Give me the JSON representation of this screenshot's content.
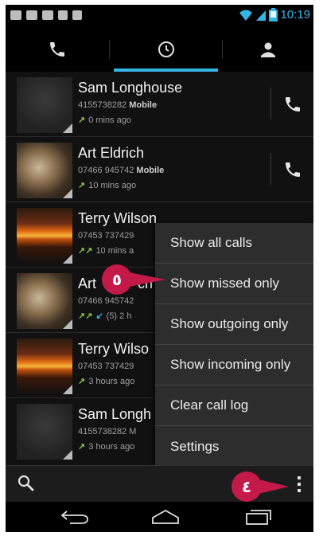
{
  "status_bar": {
    "time": "10:19",
    "notification_icons": [
      "message-icon",
      "email-icon",
      "voicemail-icon",
      "download-icon",
      "download-icon"
    ],
    "status_icons": [
      "wifi-icon",
      "signal-icon",
      "battery-icon"
    ]
  },
  "tabs": [
    {
      "icon": "phone-icon",
      "selected": false
    },
    {
      "icon": "clock-icon",
      "selected": true
    },
    {
      "icon": "contact-icon",
      "selected": false
    }
  ],
  "call_log": [
    {
      "name": "Sam Longhouse",
      "number": "4155738282",
      "type": "Mobile",
      "direction": "outgoing",
      "time": "0 mins ago",
      "avatar": "default"
    },
    {
      "name": "Art Eldrich",
      "number": "07466 945742",
      "type": "Mobile",
      "direction": "outgoing",
      "time": "10 mins ago",
      "avatar": "cat"
    },
    {
      "name": "Terry Wilson",
      "number": "07453 737429",
      "type": "",
      "direction": "outgoing",
      "time": "10 mins a",
      "avatar": "sunset"
    },
    {
      "name": "Art",
      "name_tail": "ch",
      "number": "07466 945742",
      "type": "",
      "direction": "mixed",
      "time": "(5) 2 h",
      "avatar": "cat"
    },
    {
      "name": "Terry Wilso",
      "number": "07453 737429",
      "type": "",
      "direction": "outgoing",
      "time": "3 hours ago",
      "avatar": "sunset"
    },
    {
      "name": "Sam Longh",
      "number": "4155738282 M",
      "type": "",
      "direction": "outgoing",
      "time": "3 hours ago",
      "avatar": "default"
    }
  ],
  "overflow_menu": {
    "items": [
      "Show all calls",
      "Show missed only",
      "Show outgoing only",
      "Show incoming only",
      "Clear call log",
      "Settings"
    ]
  },
  "badges": {
    "step_menu": "٥",
    "step_overflow": "٤"
  },
  "colors": {
    "accent": "#33b5e5",
    "badge": "#c41a4a",
    "outgoing_arrow": "#8bc34a"
  }
}
